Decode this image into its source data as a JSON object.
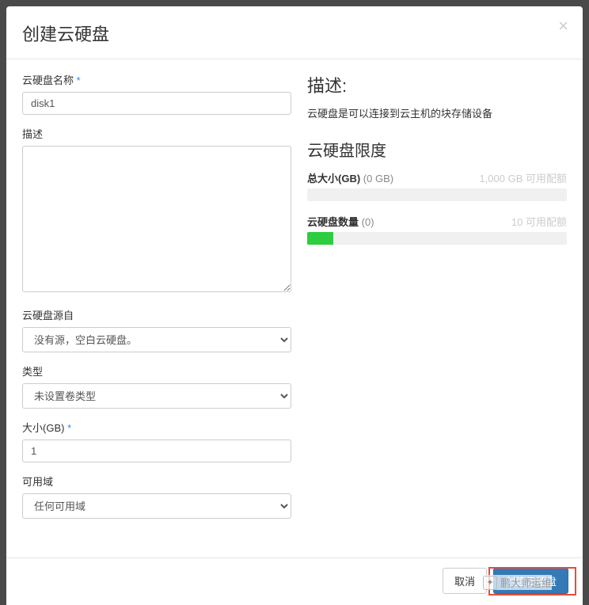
{
  "modal": {
    "title": "创建云硬盘",
    "close": "×"
  },
  "form": {
    "name_label": "云硬盘名称",
    "name_value": "disk1",
    "desc_label": "描述",
    "desc_value": "",
    "source_label": "云硬盘源自",
    "source_selected": "没有源，空白云硬盘。",
    "type_label": "类型",
    "type_selected": "未设置卷类型",
    "size_label": "大小(GB)",
    "size_value": "1",
    "az_label": "可用域",
    "az_selected": "任何可用域"
  },
  "info": {
    "desc_heading": "描述:",
    "desc_text": "云硬盘是可以连接到云主机的块存储设备",
    "quota_heading": "云硬盘限度",
    "total_size_label": "总大小(GB)",
    "total_size_current": "(0 GB)",
    "total_size_avail": "1,000 GB 可用配额",
    "count_label": "云硬盘数量",
    "count_current": "(0)",
    "count_avail": "10 可用配额"
  },
  "footer": {
    "cancel": "取消",
    "submit": "创建云硬盘"
  },
  "watermark": {
    "text": "鹏大师运维"
  }
}
